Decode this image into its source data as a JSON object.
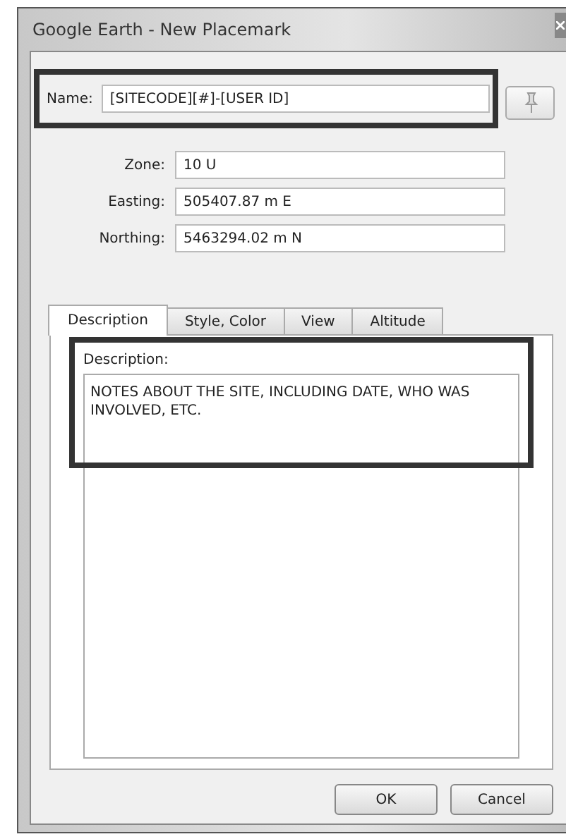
{
  "window": {
    "title": "Google Earth - New Placemark"
  },
  "name": {
    "label": "Name:",
    "value": "[SITECODE][#]-[USER ID]"
  },
  "coordinates": [
    {
      "label": "Zone:",
      "value": "10 U"
    },
    {
      "label": "Easting:",
      "value": "505407.87 m E"
    },
    {
      "label": "Northing:",
      "value": "5463294.02 m N"
    }
  ],
  "tabs": [
    {
      "label": "Description",
      "selected": true
    },
    {
      "label": "Style, Color",
      "selected": false
    },
    {
      "label": "View",
      "selected": false
    },
    {
      "label": "Altitude",
      "selected": false
    }
  ],
  "description": {
    "label": "Description:",
    "value": "NOTES ABOUT THE SITE, INCLUDING DATE, WHO WAS INVOLVED, ETC."
  },
  "buttons": [
    "OK",
    "Cancel"
  ]
}
